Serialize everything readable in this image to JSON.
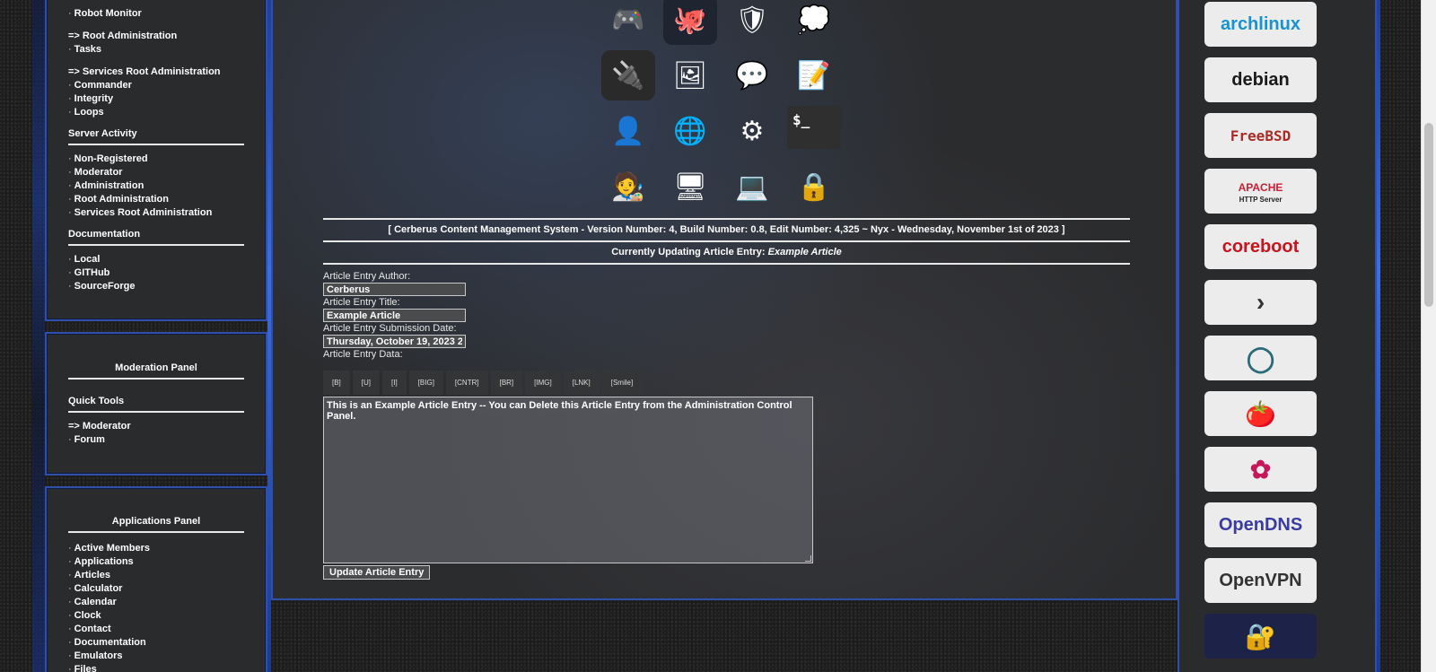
{
  "left_nav": {
    "top_links": [
      "Robot Monitor"
    ],
    "root_admin": {
      "header": "=> Root Administration",
      "items": [
        "Tasks"
      ]
    },
    "services_root_admin": {
      "header": "=> Services Root Administration",
      "items": [
        "Commander",
        "Integrity",
        "Loops"
      ]
    },
    "server_activity": {
      "title": "Server Activity",
      "items": [
        "Non-Registered",
        "Moderator",
        "Administration",
        "Root Administration",
        "Services Root Administration"
      ]
    },
    "documentation": {
      "title": "Documentation",
      "items": [
        "Local",
        "GITHub",
        "SourceForge"
      ]
    }
  },
  "moderation_panel": {
    "title": "Moderation Panel",
    "quick_tools_title": "Quick Tools",
    "moderator_link": "=> Moderator",
    "items": [
      "Forum"
    ]
  },
  "applications_panel": {
    "title": "Applications Panel",
    "items": [
      "Active Members",
      "Applications",
      "Articles",
      "Calculator",
      "Calendar",
      "Clock",
      "Contact",
      "Documentation",
      "Emulators",
      "Files"
    ]
  },
  "bullet": "·",
  "icons": [
    {
      "name": "gamepad-icon",
      "glyph": "🎮",
      "bg": "transparent"
    },
    {
      "name": "github-icon",
      "glyph": "🐙",
      "bg": "#1e2430"
    },
    {
      "name": "security-badge-icon",
      "glyph": "🛡",
      "bg": "transparent"
    },
    {
      "name": "chat-bubble-icon",
      "glyph": "💭",
      "bg": "transparent"
    },
    {
      "name": "power-socket-icon",
      "glyph": "🔌",
      "bg": "#2a2a2a"
    },
    {
      "name": "photos-icon",
      "glyph": "🖼",
      "bg": "transparent"
    },
    {
      "name": "messages-icon",
      "glyph": "💬",
      "bg": "transparent"
    },
    {
      "name": "notepad-icon",
      "glyph": "📝",
      "bg": "transparent"
    },
    {
      "name": "user-icon",
      "glyph": "👤",
      "bg": "transparent"
    },
    {
      "name": "network-icon",
      "glyph": "🌐",
      "bg": "transparent"
    },
    {
      "name": "settings-gear-icon",
      "glyph": "⚙",
      "bg": "transparent"
    },
    {
      "name": "terminal-icon",
      "glyph": "$_",
      "bg": "#2f2f2f"
    },
    {
      "name": "desktop-user-icon",
      "glyph": "🧑‍🎨",
      "bg": "transparent"
    },
    {
      "name": "monitor-icon",
      "glyph": "🖥",
      "bg": "transparent"
    },
    {
      "name": "remote-desktop-icon",
      "glyph": "💻",
      "bg": "transparent"
    },
    {
      "name": "lock-icon",
      "glyph": "🔒",
      "bg": "transparent"
    }
  ],
  "version_line": "[ Cerberus Content Management System - Version Number: 4, Build Number: 0.8, Edit Number: 4,325 ~ Nyx - Wednesday, November 1st of 2023 ]",
  "updating": {
    "prefix": "Currently Updating Article Entry: ",
    "article": "Example Article"
  },
  "form": {
    "author_label": "Article Entry Author:",
    "author_value": "Cerberus",
    "title_label": "Article Entry Title:",
    "title_value": "Example Article",
    "date_label": "Article Entry Submission Date:",
    "date_value": "Thursday, October 19, 2023 2",
    "data_label": "Article Entry Data:",
    "toolbar": [
      "[B]",
      "[U]",
      "[I]",
      "[BIG]",
      "[CNTR]",
      "[BR]",
      "[IMG]",
      "[LNK]",
      "[Smile]"
    ],
    "body": "This is an Example Article Entry -- You can Delete this Article Entry from the Administration Control Panel.",
    "submit": "Update Article Entry"
  },
  "right_badges": [
    {
      "name": "archlinux-badge",
      "label": "archlinux",
      "color": "#1793d1",
      "bg": "#ececec"
    },
    {
      "name": "debian-badge",
      "label": "debian",
      "color": "#1a1a1a",
      "bg": "#ececec"
    },
    {
      "name": "freebsd-badge",
      "label": "FreeBSD",
      "color": "#ab2b28",
      "bg": "#ececec"
    },
    {
      "name": "apache-badge",
      "label": "APACHE",
      "color": "#c92037",
      "bg": "#ececec"
    },
    {
      "name": "coreboot-badge",
      "label": "coreboot",
      "color": "#c8141e",
      "bg": "#ececec"
    },
    {
      "name": "prompt-badge",
      "label": "›",
      "color": "#333333",
      "bg": "#ececec"
    },
    {
      "name": "lxc-badge",
      "label": "◯",
      "color": "#2b6a7a",
      "bg": "#ececec"
    },
    {
      "name": "tomato-badge",
      "label": "🍅",
      "color": "#d62828",
      "bg": "#ececec"
    },
    {
      "name": "lotus-badge",
      "label": "✿",
      "color": "#c4185a",
      "bg": "#ececec"
    },
    {
      "name": "opendns-badge",
      "label": "OpenDNS",
      "color": "#3b3ba0",
      "bg": "#ececec"
    },
    {
      "name": "openvpn-badge",
      "label": "OpenVPN",
      "color": "#333333",
      "bg": "#ececec"
    },
    {
      "name": "security-tool-badge",
      "label": "🔐",
      "color": "#e04a6a",
      "bg": "#1d2248"
    }
  ],
  "apache_sub": "HTTP Server"
}
